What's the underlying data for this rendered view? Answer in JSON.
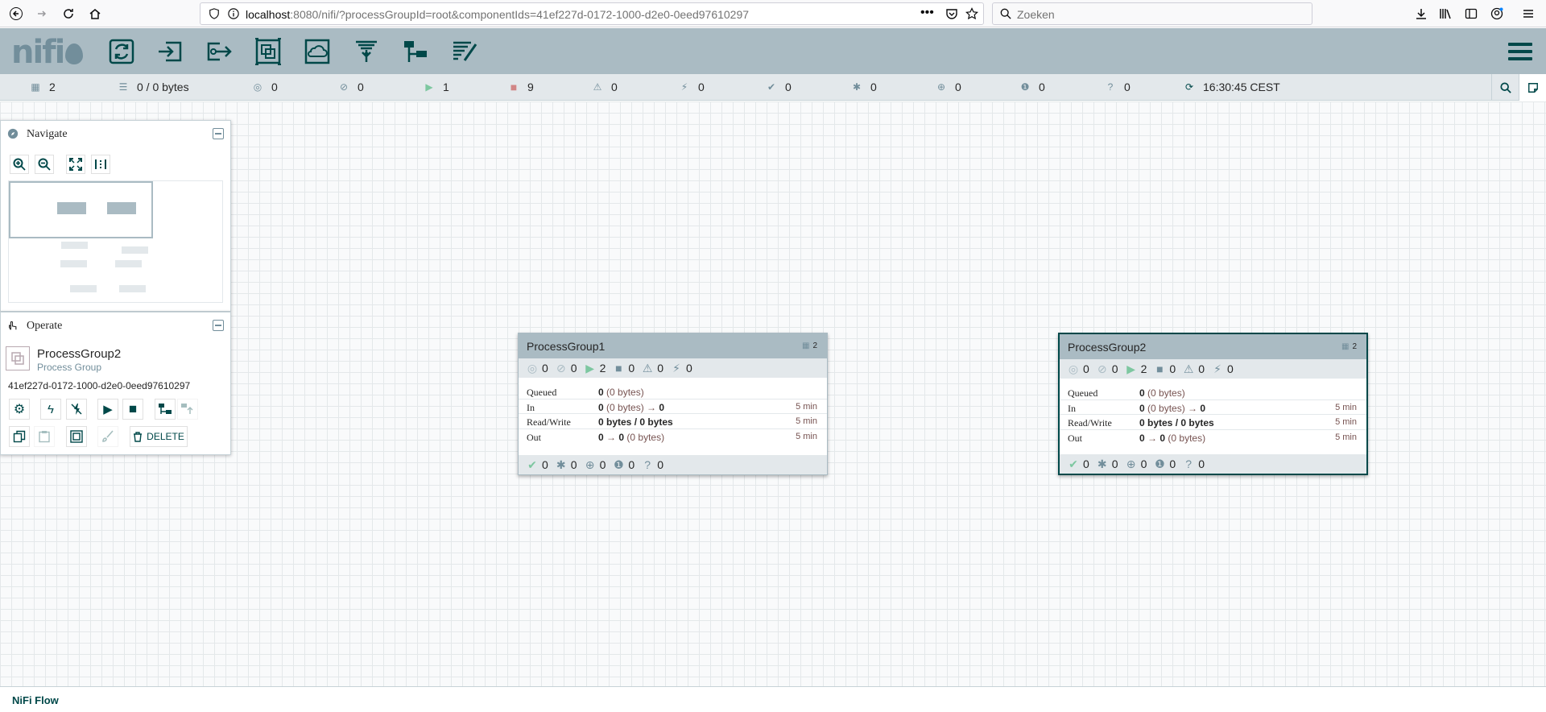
{
  "browser": {
    "url_prefix": "",
    "url_host": "localhost",
    "url_rest": ":8080/nifi/?processGroupId=root&componentIds=41ef227d-0172-1000-d2e0-0eed97610297",
    "search_placeholder": "Zoeken"
  },
  "header": {
    "logo": "nifi",
    "tools": [
      "processor-tool",
      "input-port-tool",
      "output-port-tool",
      "process-group-tool",
      "remote-process-group-tool",
      "funnel-tool",
      "template-tool",
      "label-tool"
    ]
  },
  "status": {
    "transmitting": "2",
    "queued": "0 / 0 bytes",
    "not_transmitting": "0",
    "disabled": "0",
    "running": "1",
    "stopped": "9",
    "invalid": "0",
    "disabled_components": "0",
    "up_to_date": "0",
    "locally_modified": "0",
    "stale": "0",
    "modified_stale": "0",
    "sync_failure": "0",
    "last_refreshed": "16:30:45 CEST"
  },
  "navigate": {
    "title": "Navigate"
  },
  "operate": {
    "title": "Operate",
    "selected_name": "ProcessGroup2",
    "selected_type": "Process Group",
    "selected_id": "41ef227d-0172-1000-d2e0-0eed97610297",
    "delete_label": "DELETE"
  },
  "process_groups": [
    {
      "name": "ProcessGroup1",
      "count": "2",
      "transmitting": "0",
      "not_transmitting": "0",
      "running": "2",
      "stopped": "0",
      "invalid": "0",
      "disabled": "0",
      "queued_b": "0",
      "queued_rest": "(0 bytes)",
      "in_b": "0",
      "in_rest": "(0 bytes) →",
      "in_b2": "0",
      "rw": "0 bytes / 0 bytes",
      "out_b": "0",
      "out_mid": "→",
      "out_b2": "0",
      "out_rest": "(0 bytes)",
      "time": "5 min",
      "up_to_date": "0",
      "modified": "0",
      "stale": "0",
      "modified_stale": "0",
      "sync_failure": "0"
    },
    {
      "name": "ProcessGroup2",
      "count": "2",
      "transmitting": "0",
      "not_transmitting": "0",
      "running": "2",
      "stopped": "0",
      "invalid": "0",
      "disabled": "0",
      "queued_b": "0",
      "queued_rest": "(0 bytes)",
      "in_b": "0",
      "in_rest": "(0 bytes) →",
      "in_b2": "0",
      "rw": "0 bytes / 0 bytes",
      "out_b": "0",
      "out_mid": "→",
      "out_b2": "0",
      "out_rest": "(0 bytes)",
      "time": "5 min",
      "up_to_date": "0",
      "modified": "0",
      "stale": "0",
      "modified_stale": "0",
      "sync_failure": "0"
    }
  ],
  "stat_labels": {
    "queued": "Queued",
    "in": "In",
    "rw": "Read/Write",
    "out": "Out"
  },
  "footer": {
    "breadcrumb": "NiFi Flow"
  },
  "colors": {
    "header": "#aabbc3",
    "accent": "#004849",
    "running": "#7dc7a0",
    "stopped": "#d18686"
  }
}
